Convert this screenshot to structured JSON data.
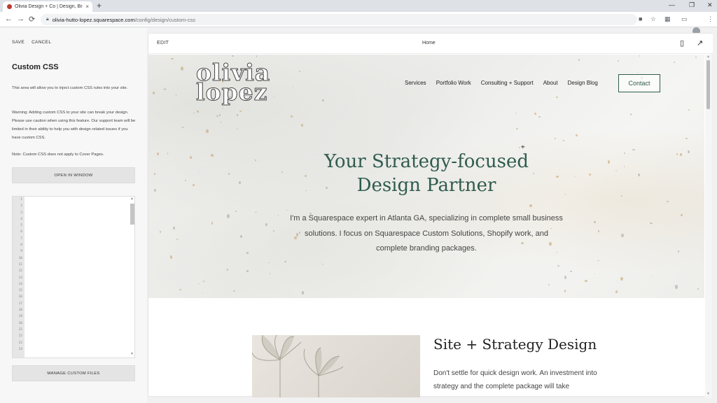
{
  "browser": {
    "tab_title": "Olivia Design + Co | Design, Bra",
    "tab_close": "×",
    "new_tab": "+",
    "url_host": "olivia-hutto-lopez.squarespace.com",
    "url_path": "/config/design/custom-css",
    "back": "←",
    "forward": "→",
    "reload": "⟳",
    "minimize": "—",
    "restore": "❐",
    "close": "✕"
  },
  "panel": {
    "save_label": "SAVE",
    "cancel_label": "CANCEL",
    "title": "Custom CSS",
    "intro": "This area will allow you to inject custom CSS rules into your site.",
    "warning": "Warning: Adding custom CSS to your site can break your design. Please use caution when using this feature. Our support team will be limited in their ability to help you with design related issues if you have custom CSS.",
    "note": "Note: Custom CSS does not apply to Cover Pages.",
    "open_window_label": "OPEN IN WINDOW",
    "manage_files_label": "MANAGE CUSTOM FILES",
    "line_numbers": [
      "1",
      "2",
      "3",
      "4",
      "5",
      "6",
      "7",
      "8",
      "9",
      "10",
      "11",
      "12",
      "13",
      "14",
      "15",
      "16",
      "17",
      "18",
      "19",
      "20",
      "21",
      "22",
      "23",
      "24"
    ]
  },
  "preview": {
    "edit_label": "EDIT",
    "page_label": "Home",
    "logo_line1": "olivia",
    "logo_line2": "lopez",
    "nav": [
      "Services",
      "Portfolio Work",
      "Consulting + Support",
      "About",
      "Design Blog"
    ],
    "contact_label": "Contact",
    "headline_line1": "Your Strategy-focused",
    "headline_line2": "Design Partner",
    "lead": "I'm a Squarespace expert in Atlanta GA, specializing in complete small business solutions. I focus on Squarespace Custom Solutions, Shopify work, and complete branding packages.",
    "section_title": "Site + Strategy Design",
    "section_body": "Don't settle for quick design work. An investment into strategy and the complete package will take",
    "accent_color": "#2f5c4f"
  },
  "icons": [
    "squarespace-favicon",
    "lock-icon",
    "camera-icon",
    "star-icon",
    "extensions-icon",
    "cast-icon",
    "mic-icon",
    "menu-icon",
    "mobile-icon",
    "open-external-icon"
  ]
}
